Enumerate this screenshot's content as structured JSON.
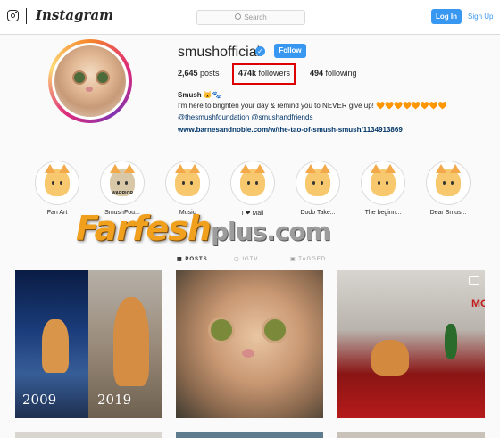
{
  "header": {
    "brand": "Instagram",
    "search_placeholder": "Search",
    "login_label": "Log In",
    "signup_label": "Sign Up"
  },
  "profile": {
    "username": "smushofficial",
    "verified_icon": "verified-badge-icon",
    "follow_label": "Follow",
    "posts_count": "2,645",
    "posts_label": "posts",
    "followers_count": "474k",
    "followers_label": "followers",
    "following_count": "494",
    "following_label": "following",
    "bio_name": "Smush 🐱🐾",
    "bio_text": "I'm here to brighten your day & remind you to NEVER give up! 🧡🧡🧡🧡🧡🧡🧡🧡",
    "bio_tags": "@thesmushfoundation @smushandfriends",
    "bio_link": "www.barnesandnoble.com/w/the-tao-of-smush-smush/1134913869"
  },
  "highlights": [
    {
      "label": "Fan Art"
    },
    {
      "label": "SmushFou...",
      "badge": "WARRIOR"
    },
    {
      "label": "Music"
    },
    {
      "label": "I ❤ Mail"
    },
    {
      "label": "Dodo Take..."
    },
    {
      "label": "The beginn..."
    },
    {
      "label": "Dear Smus..."
    }
  ],
  "watermark": {
    "main": "Farfesh",
    "sub": "plus.com"
  },
  "tabs": [
    {
      "label": "POSTS",
      "active": true
    },
    {
      "label": "IGTV",
      "active": false
    },
    {
      "label": "TAGGED",
      "active": false
    }
  ],
  "posts": [
    {
      "caption_left": "2009",
      "caption_right": "2019"
    },
    {},
    {
      "sign_text": "MOO"
    }
  ],
  "colors": {
    "accent": "#3897f0",
    "highlight_box": "#dd0000",
    "watermark": "#f0a01c"
  }
}
